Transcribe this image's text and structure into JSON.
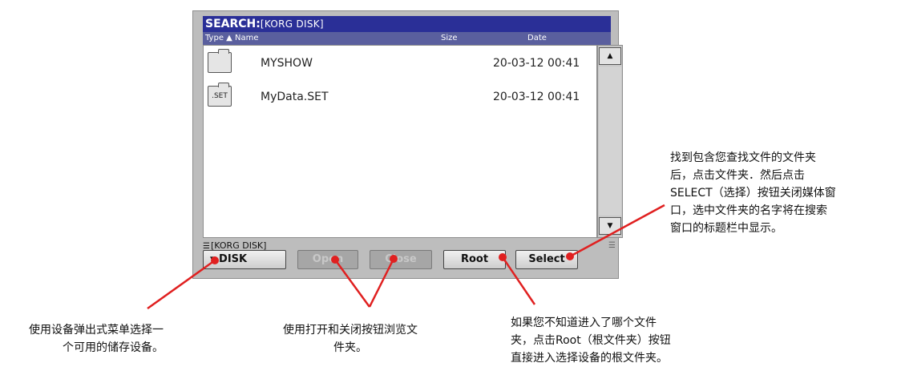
{
  "window": {
    "title_prefix": "SEARCH:",
    "title_path": "[KORG DISK]",
    "columns": {
      "type": "Type ▲",
      "name": "Name",
      "size": "Size",
      "date": "Date"
    },
    "files": [
      {
        "icon": "folder",
        "icon_label": "",
        "name": "MYSHOW",
        "date": "20-03-12 00:41"
      },
      {
        "icon": "set-file",
        "icon_label": ".SET",
        "name": "MyData.SET",
        "date": "20-03-12 00:41"
      }
    ],
    "scroll_up_glyph": "▲",
    "scroll_down_glyph": "▼",
    "status_path": "[KORG DISK]",
    "buttons": {
      "device": "▾ DISK",
      "open": "Open",
      "close": "Close",
      "root": "Root",
      "select": "Select"
    }
  },
  "annotations": {
    "select_note": "找到包含您查找文件的文件夹\n后，点击文件夹．然后点击\nSELECT（选择）按钮关闭媒体窗\n口，选中文件夹的名字将在搜索\n窗口的标题栏中显示。",
    "device_note": "使用设备弹出式菜单选择一\n个可用的储存设备。",
    "open_close_note": "使用打开和关闭按钮浏览文\n件夹。",
    "root_note": "如果您不知道进入了哪个文件\n夹，点击Root（根文件夹）按钮\n直接进入选择设备的根文件夹。"
  },
  "colors": {
    "title_bar": "#2a2f97",
    "header_bar": "#5a5f9e",
    "window_bg": "#bdbdbd",
    "callout_line": "#e02020"
  }
}
